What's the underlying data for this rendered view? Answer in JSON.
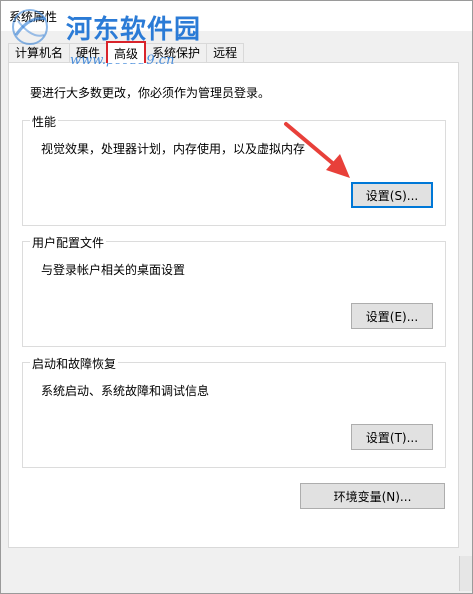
{
  "window": {
    "title": "系统属性"
  },
  "watermark": {
    "title": "河东软件园",
    "url": "www.pc0359.cn"
  },
  "tabs": [
    {
      "label": "计算机名",
      "active": false
    },
    {
      "label": "硬件",
      "active": false
    },
    {
      "label": "高级",
      "active": true
    },
    {
      "label": "系统保护",
      "active": false
    },
    {
      "label": "远程",
      "active": false
    }
  ],
  "advanced": {
    "intro": "要进行大多数更改，你必须作为管理员登录。",
    "performance": {
      "title": "性能",
      "description": "视觉效果，处理器计划，内存使用，以及虚拟内存",
      "button": "设置(S)..."
    },
    "user_profiles": {
      "title": "用户配置文件",
      "description": "与登录帐户相关的桌面设置",
      "button": "设置(E)..."
    },
    "startup_recovery": {
      "title": "启动和故障恢复",
      "description": "系统启动、系统故障和调试信息",
      "button": "设置(T)..."
    },
    "environment_button": "环境变量(N)..."
  },
  "colors": {
    "highlight_box": "#d9242b",
    "annotation_arrow": "#e8403a",
    "focus_border": "#0078d7",
    "watermark": "#2b7bd6"
  }
}
